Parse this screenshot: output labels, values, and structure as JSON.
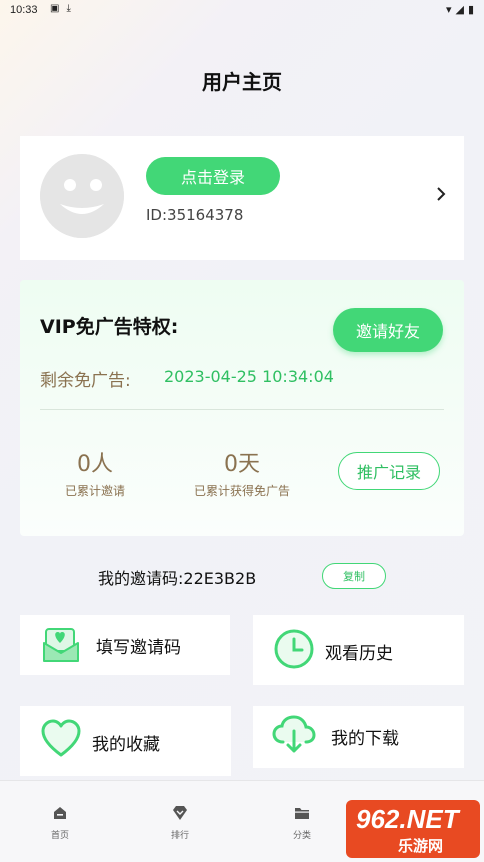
{
  "status_bar": {
    "time": "10:33"
  },
  "header": {
    "title": "用户主页"
  },
  "profile": {
    "login_label": "点击登录",
    "user_id": "ID:35164378"
  },
  "vip": {
    "title": "VIP免广告特权:",
    "invite_label": "邀请好友",
    "remain_label": "剩余免广告:",
    "remain_value": "2023-04-25 10:34:04",
    "people_value": "0人",
    "people_label": "已累计邀请",
    "days_value": "0天",
    "days_label": "已累计获得免广告",
    "promo_label": "推广记录"
  },
  "invite_code": {
    "text": "我的邀请码:22E3B2B",
    "copy_label": "复制"
  },
  "tiles": [
    {
      "label": "填写邀请码",
      "icon": "envelope-heart-icon"
    },
    {
      "label": "观看历史",
      "icon": "clock-icon"
    },
    {
      "label": "我的收藏",
      "icon": "heart-icon"
    },
    {
      "label": "我的下载",
      "icon": "cloud-download-icon"
    }
  ],
  "nav": [
    {
      "label": "首页",
      "icon": "home-icon"
    },
    {
      "label": "排行",
      "icon": "rank-icon"
    },
    {
      "label": "分类",
      "icon": "folder-icon"
    }
  ],
  "watermark": {
    "brand": "962.NET",
    "sub": "乐游网"
  },
  "colors": {
    "accent": "#42d777",
    "gold_text": "#8a7250"
  }
}
